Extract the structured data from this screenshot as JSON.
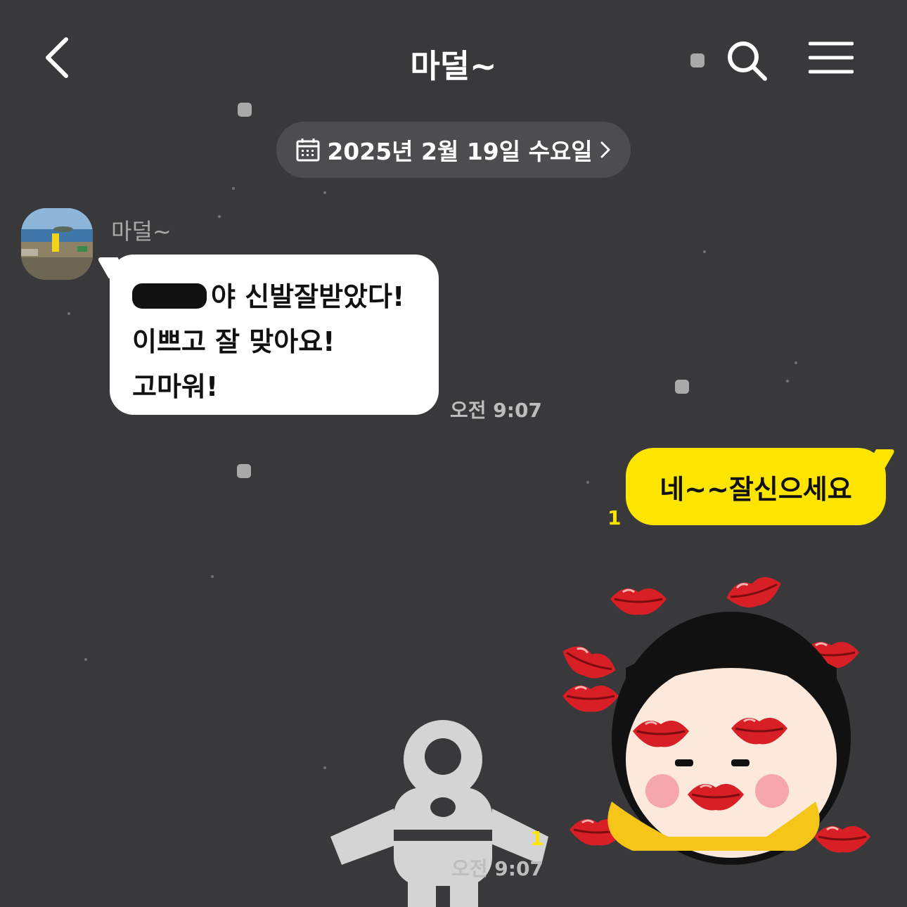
{
  "header": {
    "title": "마덜~"
  },
  "date_divider": {
    "label": "2025년 2월 19일 수요일"
  },
  "messages": [
    {
      "sender": "마덜~",
      "lines": [
        "야 신발잘받았다!",
        "이쁘고 잘 맞아요!",
        "고마워!"
      ],
      "time": "오전 9:07"
    },
    {
      "text": "네~~잘신으세요",
      "unread": "1"
    },
    {
      "type": "emoticon",
      "unread": "1",
      "time": "오전 9:07"
    }
  ],
  "colors": {
    "background": "#39393b",
    "my_bubble": "#fee500",
    "their_bubble": "#ffffff",
    "unread": "#fee500"
  },
  "icons": [
    "chevron-left-icon",
    "search-icon",
    "menu-icon",
    "calendar-icon",
    "chevron-right-icon"
  ]
}
